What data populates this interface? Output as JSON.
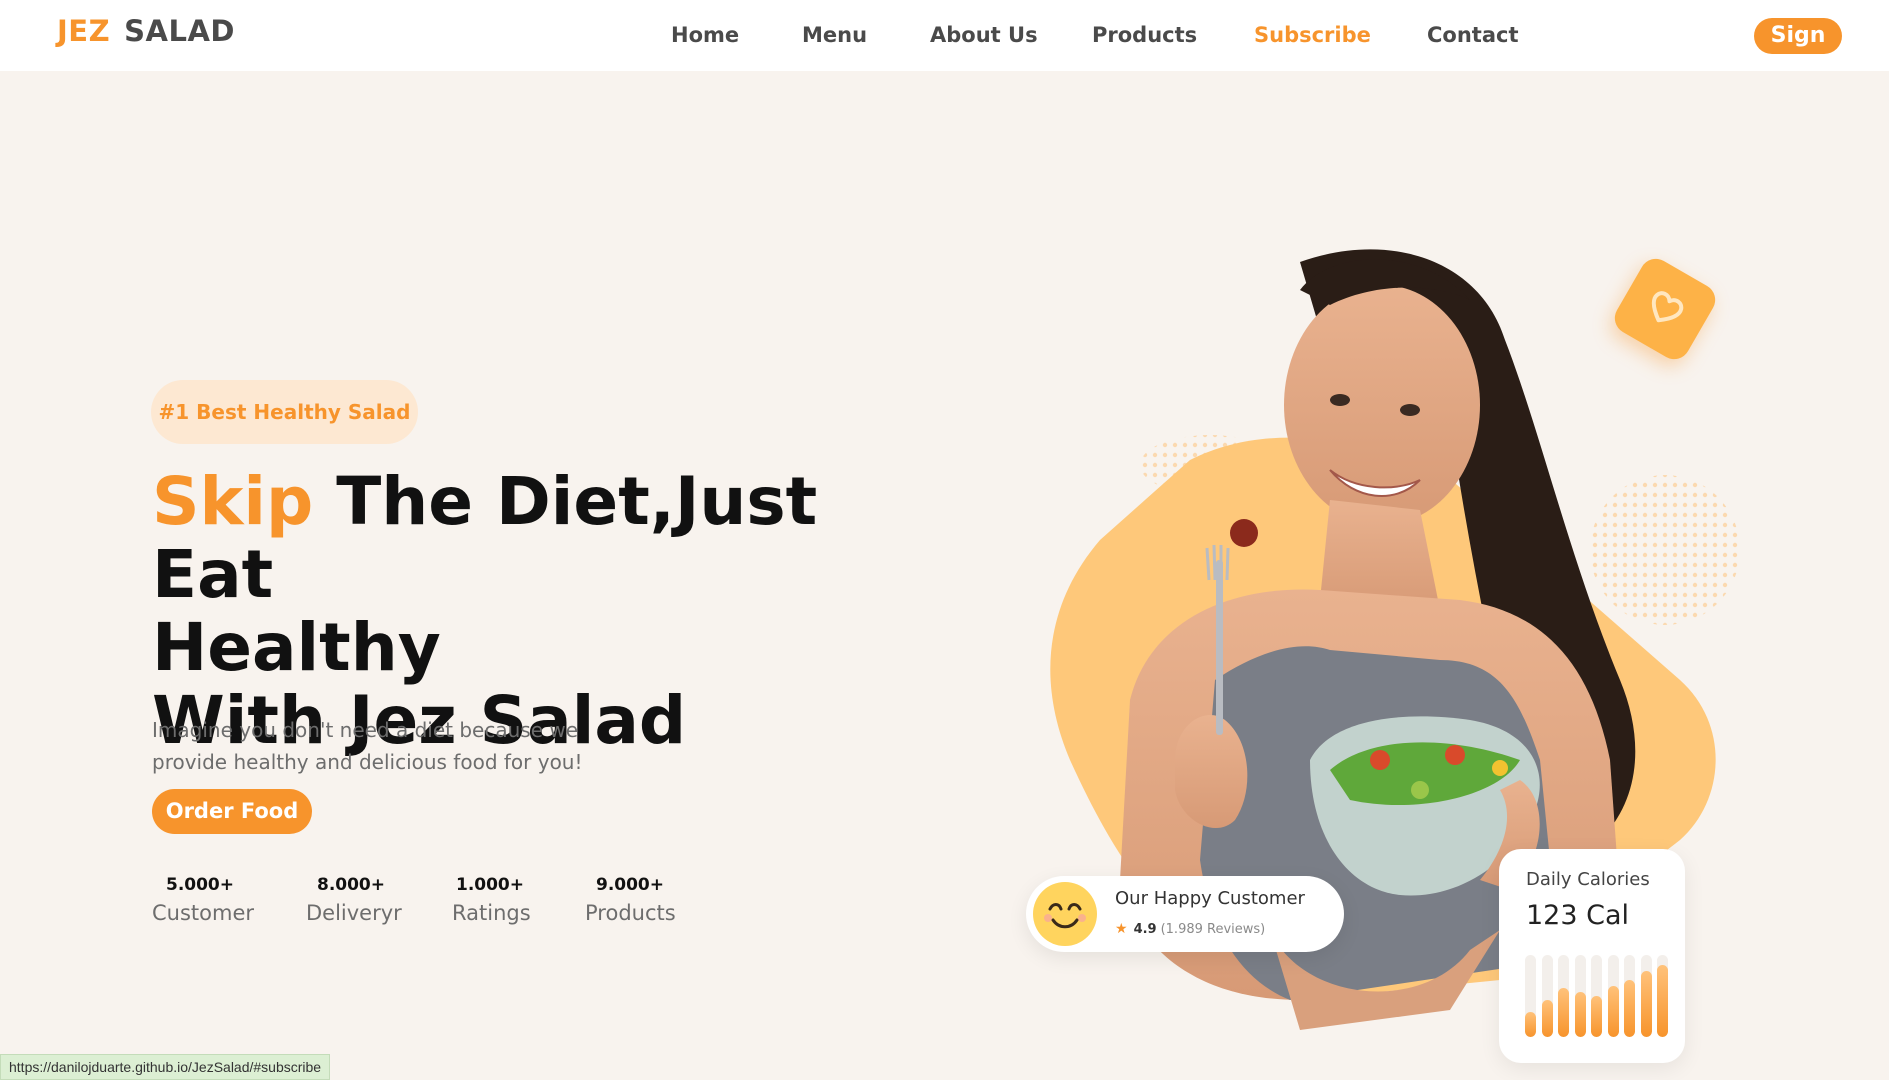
{
  "header": {
    "logo": {
      "part1": "JEZ",
      "part2": "SALAD"
    },
    "nav": [
      {
        "label": "Home",
        "active": false
      },
      {
        "label": "Menu",
        "active": false
      },
      {
        "label": "About Us",
        "active": false
      },
      {
        "label": "Products",
        "active": false
      },
      {
        "label": "Subscribe",
        "active": true
      },
      {
        "label": "Contact",
        "active": false
      }
    ],
    "sign_label": "Sign"
  },
  "hero": {
    "badge": "#1 Best Healthy Salad",
    "headline": {
      "accent": "Skip",
      "line1_rest": " The Diet,Just Eat",
      "line2": "Healthy",
      "line3": "With Jez Salad"
    },
    "subtext": "Imagine you don't need a diet because we provide healthy and delicious food for you!",
    "cta_label": "Order Food",
    "stats": [
      {
        "value": "5.000+",
        "label": "Customer"
      },
      {
        "value": "8.000+",
        "label": "Deliveryr"
      },
      {
        "value": "1.000+",
        "label": "Ratings"
      },
      {
        "value": "9.000+",
        "label": "Products"
      }
    ]
  },
  "happy_customer": {
    "title": "Our Happy Customer",
    "rating": "4.9",
    "reviews": "(1.989 Reviews)",
    "icon": "smiling-face-icon"
  },
  "calories": {
    "label": "Daily Calories",
    "value": "123 Cal",
    "bar_levels": [
      0.3,
      0.45,
      0.6,
      0.55,
      0.5,
      0.62,
      0.7,
      0.8,
      0.88
    ]
  },
  "status_url": "https://danilojduarte.github.io/JezSalad/#subscribe",
  "colors": {
    "accent": "#f7942c",
    "background": "#f8f3ee",
    "blob": "#fec87a"
  }
}
